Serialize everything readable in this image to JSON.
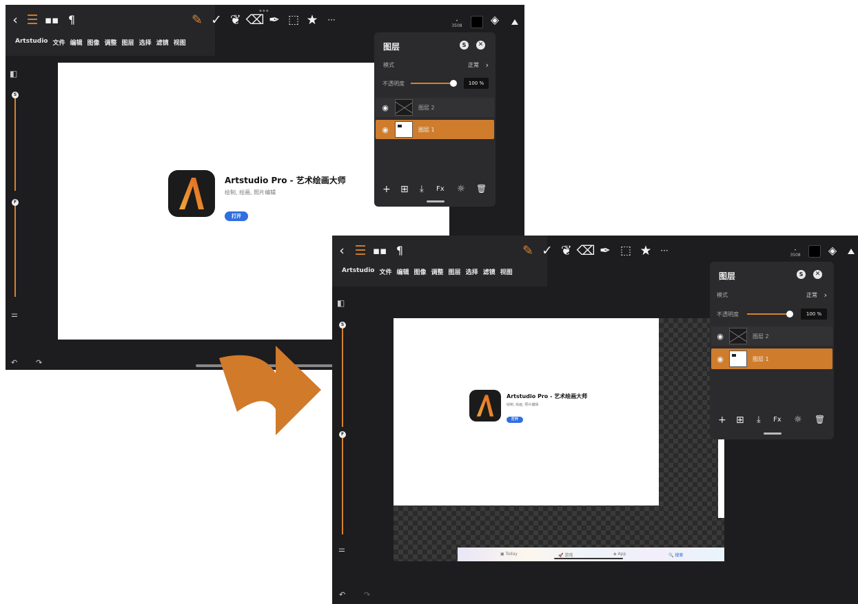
{
  "toolbar": {
    "menu": [
      "Artstudio",
      "文件",
      "编辑",
      "图像",
      "调整",
      "图层",
      "选择",
      "滤镜",
      "视图"
    ],
    "brush_size": "3508",
    "handle_dots": "•••",
    "more_label": "···"
  },
  "app_card": {
    "title": "Artstudio Pro - 艺术绘画大师",
    "subtitle": "绘制, 绘画, 照片编辑",
    "open_label": "打开"
  },
  "layers_panel": {
    "title": "图层",
    "mode_label": "模式",
    "mode_value": "正常",
    "opacity_label": "不透明度",
    "opacity_value": "100 %",
    "opacity": 1.0,
    "layers": [
      {
        "name": "图层 2",
        "visible": true,
        "selected": false
      },
      {
        "name": "图层 1",
        "visible": true,
        "selected": true
      }
    ],
    "actions": [
      "+",
      "Fx"
    ]
  },
  "rail": {
    "size_knob": "S",
    "flow_knob": "F"
  },
  "dock": {
    "items": [
      "Today",
      "游戏",
      "App",
      "搜索"
    ]
  },
  "colors": {
    "accent": "#d7822d",
    "panel": "#2b2b2d",
    "background": "#1d1d1f",
    "link": "#2f6fe0",
    "arrow": "#d07a2a"
  }
}
